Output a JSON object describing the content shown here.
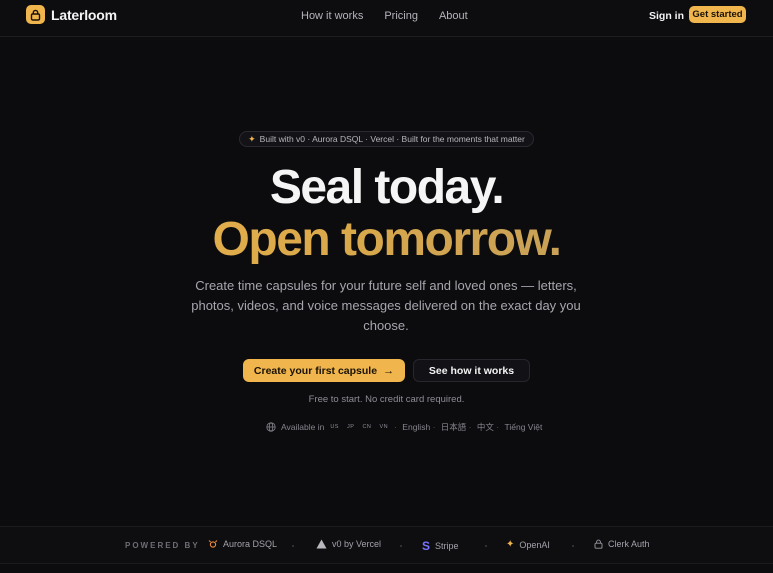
{
  "brand": {
    "name": "Laterloom",
    "accent": "#f0b54c"
  },
  "nav": {
    "links": [
      {
        "label": "How it works"
      },
      {
        "label": "Pricing"
      },
      {
        "label": "About"
      }
    ],
    "signin_label": "Sign in",
    "cta_label": "Get started"
  },
  "hero": {
    "badge_text": "Built with v0 · Aurora DSQL · Vercel · Built for the moments that matter",
    "headline_1": "Seal today.",
    "headline_2": "Open tomorrow.",
    "subtitle": "Create time capsules for your future self and loved ones — letters, photos, videos, and voice messages delivered on the exact day you choose.",
    "primary_cta": "Create your first capsule",
    "secondary_cta": "See how it works",
    "free_note": "Free to start. No credit card required.",
    "available_label": "Available in",
    "flags": [
      "US",
      "JP",
      "CN",
      "VN"
    ],
    "languages": [
      "English",
      "日本語",
      "中文",
      "Tiếng Việt"
    ]
  },
  "powered_by": {
    "label": "POWERED BY",
    "partners": [
      {
        "name": "Aurora DSQL",
        "icon": "aurora-icon"
      },
      {
        "name": "v0 by Vercel",
        "icon": "vercel-triangle-icon"
      },
      {
        "name": "Stripe",
        "icon": "stripe-s-icon"
      },
      {
        "name": "OpenAI",
        "icon": "openai-spark-icon"
      },
      {
        "name": "Clerk Auth",
        "icon": "lock-icon"
      }
    ]
  }
}
